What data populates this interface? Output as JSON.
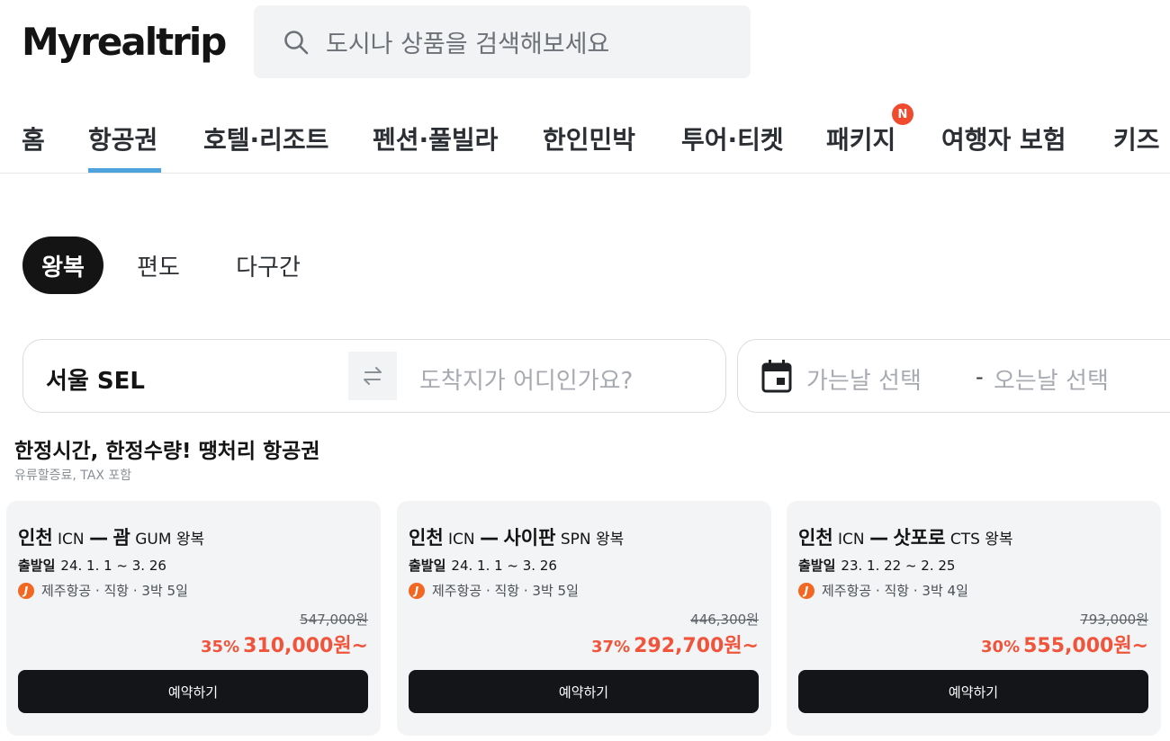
{
  "header": {
    "logo": "Myrealtrip",
    "search_placeholder": "도시나 상품을 검색해보세요"
  },
  "nav": {
    "items": [
      "홈",
      "항공권",
      "호텔·리조트",
      "펜션·풀빌라",
      "한인민박",
      "투어·티켓",
      "패키지",
      "여행자 보험",
      "키즈"
    ],
    "active": "항공권",
    "badge": "N"
  },
  "trip_types": [
    "왕복",
    "편도",
    "다구간"
  ],
  "route": {
    "origin": "서울 SEL",
    "destination_placeholder": "도착지가 어디인가요?"
  },
  "dates": {
    "depart_placeholder": "가는날 선택",
    "separator": "-",
    "return_placeholder": "오는날 선택"
  },
  "section": {
    "title": "한정시간, 한정수량!  땡처리 항공권",
    "subtitle": "유류할증료, TAX 포함"
  },
  "deals": [
    {
      "from_city": "인천",
      "from_code": "ICN",
      "dash": "—",
      "to_city": "괌",
      "to_code": "GUM",
      "trip": "왕복",
      "date_label": "출발일",
      "dates": "24. 1. 1 ~ 3. 26",
      "airline_info": "제주항공 · 직항 · 3박 5일",
      "original_price": "547,000원",
      "discount": "35%",
      "price": "310,000원~",
      "button": "예약하기"
    },
    {
      "from_city": "인천",
      "from_code": "ICN",
      "dash": "—",
      "to_city": "사이판",
      "to_code": "SPN",
      "trip": "왕복",
      "date_label": "출발일",
      "dates": "24. 1. 1 ~ 3. 26",
      "airline_info": "제주항공 · 직항 · 3박 5일",
      "original_price": "446,300원",
      "discount": "37%",
      "price": "292,700원~",
      "button": "예약하기"
    },
    {
      "from_city": "인천",
      "from_code": "ICN",
      "dash": "—",
      "to_city": "삿포로",
      "to_code": "CTS",
      "trip": "왕복",
      "date_label": "출발일",
      "dates": "23. 1. 22 ~ 2. 25",
      "airline_info": "제주항공 · 직항 · 3박 4일",
      "original_price": "793,000원",
      "discount": "30%",
      "price": "555,000원~",
      "button": "예약하기"
    }
  ],
  "colors": {
    "accent_underline": "#4ea2dd",
    "badge": "#f04a2f",
    "discount": "#f0553c",
    "button": "#141518"
  }
}
